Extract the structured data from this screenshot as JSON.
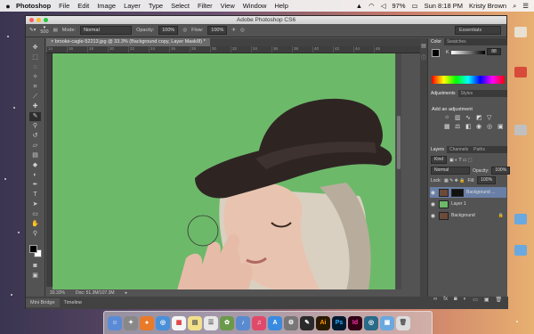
{
  "menubar": {
    "apple": "",
    "app": "Photoshop",
    "items": [
      "File",
      "Edit",
      "Image",
      "Layer",
      "Type",
      "Select",
      "Filter",
      "View",
      "Window",
      "Help"
    ],
    "battery": "97%",
    "clock": "Sun 8:18 PM",
    "user": "Kristy Brown"
  },
  "window": {
    "title": "Adobe Photoshop CS6",
    "options": {
      "brush_size": "500",
      "mode_label": "Mode:",
      "mode_value": "Normal",
      "opacity_label": "Opacity:",
      "opacity_value": "100%",
      "flow_label": "Flow:",
      "flow_value": "100%",
      "workspace": "Essentials"
    },
    "doc_tab": "brooke-cagle-52213.jpg @ 33.3% (Background copy, Layer Mask/8) *",
    "ruler_ticks": [
      "14",
      "16",
      "18",
      "20",
      "22",
      "24",
      "26",
      "28",
      "30",
      "32",
      "34",
      "36",
      "38",
      "40",
      "42",
      "44",
      "46"
    ],
    "status": {
      "zoom": "33.33%",
      "doc": "Doc: 51.3M/107.3M"
    },
    "bottom_tabs": [
      "Mini Bridge",
      "Timeline"
    ]
  },
  "panels": {
    "color_tabs": [
      "Color",
      "Swatches"
    ],
    "color_channel": "K",
    "color_value": "88",
    "adj_tabs": [
      "Adjustments",
      "Styles"
    ],
    "adj_title": "Add an adjustment",
    "layers_tabs": [
      "Layers",
      "Channels",
      "Paths"
    ],
    "kind": "Kind",
    "blend": "Normal",
    "opacity_label": "Opacity:",
    "opacity": "100%",
    "lock_label": "Lock:",
    "fill_label": "Fill:",
    "fill": "100%",
    "layers": [
      {
        "name": "Background ...",
        "selected": true,
        "thumb": "#6b4a3a",
        "mask": true
      },
      {
        "name": "Layer 1",
        "selected": false,
        "thumb": "#6db96a",
        "mask": false
      },
      {
        "name": "Background",
        "selected": false,
        "thumb": "#6b4a3a",
        "mask": false,
        "locked": true
      }
    ]
  },
  "colors": {
    "canvas_bg": "#6db96a",
    "hat": "#2e2523",
    "selected_layer": "#6a7fa6"
  }
}
